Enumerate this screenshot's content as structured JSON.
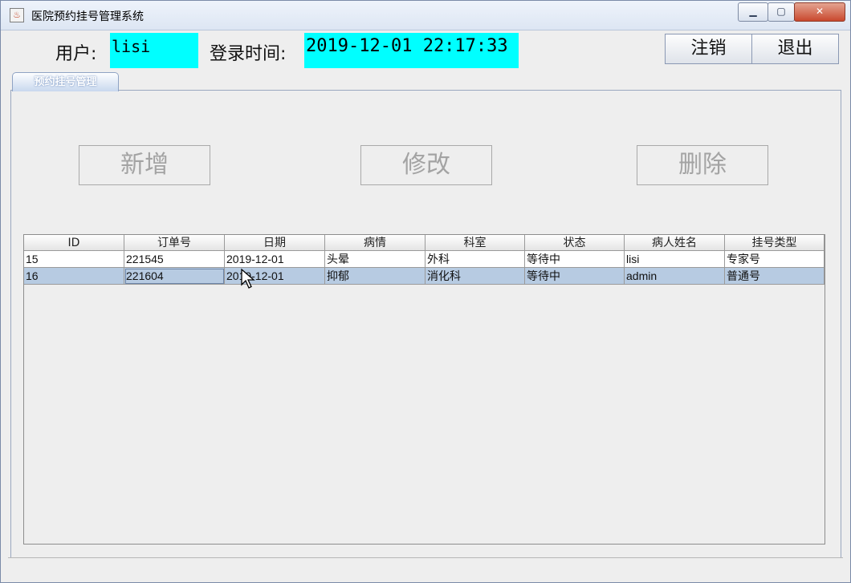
{
  "window": {
    "title": "医院预约挂号管理系统",
    "app_icon": "java-cup-icon"
  },
  "header": {
    "user_label": "用户:",
    "user_value": "lisi",
    "login_label": "登录时间:",
    "login_value": "2019-12-01 22:17:33",
    "logout_label": "注销",
    "exit_label": "退出",
    "highlight_color": "#00ffff"
  },
  "tabs": [
    {
      "label": "预约挂号管理"
    }
  ],
  "actions": {
    "add": "新增",
    "edit": "修改",
    "delete": "删除"
  },
  "table": {
    "columns": [
      "ID",
      "订单号",
      "日期",
      "病情",
      "科室",
      "状态",
      "病人姓名",
      "挂号类型"
    ],
    "rows": [
      [
        "15",
        "221545",
        "2019-12-01",
        "头晕",
        "外科",
        "等待中",
        "lisi",
        "专家号"
      ],
      [
        "16",
        "221604",
        "2019-12-01",
        "抑郁",
        "消化科",
        "等待中",
        "admin",
        "普通号"
      ]
    ],
    "selected_row_color": "#b7cbe2"
  }
}
